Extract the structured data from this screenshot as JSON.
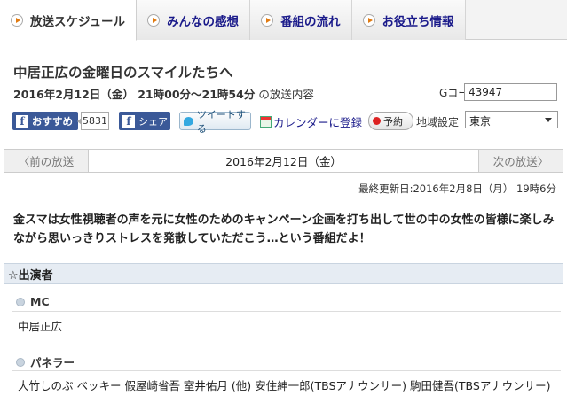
{
  "tabs": [
    {
      "label": "放送スケジュール",
      "active": true
    },
    {
      "label": "みんなの感想",
      "active": false
    },
    {
      "label": "番組の流れ",
      "active": false
    },
    {
      "label": "お役立ち情報",
      "active": false
    }
  ],
  "program": {
    "title": "中居正広の金曜日のスマイルたちへ",
    "air_time": "2016年2月12日（金） 21時00分～21時54分",
    "air_suffix": "の放送内容",
    "gcode_label": "Gコード:",
    "gcode_value": "43947"
  },
  "actions": {
    "fb_recommend": "おすすめ",
    "fb_count": "5831",
    "fb_share": "シェア",
    "tweet": "ツイートする",
    "calendar": "カレンダーに登録",
    "reserve": "予約",
    "area_label": "地域設定",
    "area_value": "東京"
  },
  "nav": {
    "prev": "〈前の放送",
    "date": "2016年2月12日（金）",
    "next": "次の放送〉"
  },
  "updated": "最終更新日:2016年2月8日（月） 19時6分",
  "description": "金スマは女性視聴者の声を元に女性のためのキャンペーン企画を打ち出して世の中の女性の皆様に楽しみながら思いっきりストレスを発散していただこう…という番組だよ！",
  "cast": {
    "heading": "☆出演者",
    "mc_label": "MC",
    "mc_names": "中居正広",
    "panel_label": "パネラー",
    "panel_names": "大竹しのぶ ベッキー 假屋崎省吾 室井佑月 (他) 安住紳一郎(TBSアナウンサー) 駒田健吾(TBSアナウンサー)"
  }
}
